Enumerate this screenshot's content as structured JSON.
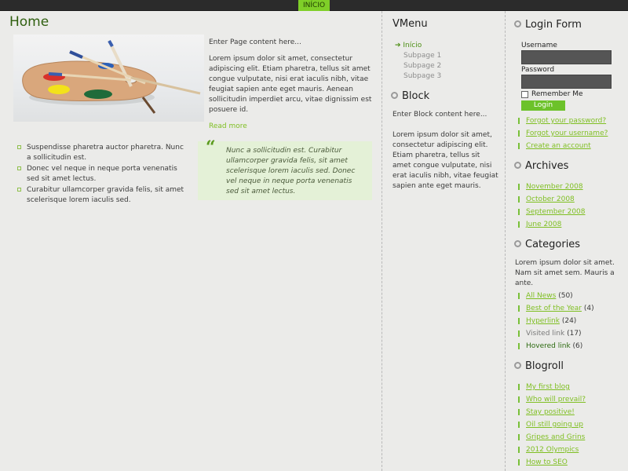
{
  "nav": {
    "item": "INÍCIO"
  },
  "main": {
    "title": "Home",
    "intro": "Enter Page content here...",
    "paragraph": "Lorem ipsum dolor sit amet, consectetur adipiscing elit. Etiam pharetra, tellus sit amet congue vulputate, nisi erat iaculis nibh, vitae feugiat sapien ante eget mauris. Aenean sollicitudin imperdiet arcu, vitae dignissim est posuere id.",
    "read_more": "Read more",
    "bullets": [
      "Suspendisse pharetra auctor pharetra. Nunc a sollicitudin est.",
      "Donec vel neque in neque porta venenatis sed sit amet lectus.",
      "Curabitur ullamcorper gravida felis, sit amet scelerisque lorem iaculis sed."
    ],
    "quote": "Nunc a sollicitudin est. Curabitur ullamcorper gravida felis, sit amet scelerisque lorem iaculis sed. Donec vel neque in neque porta venenatis sed sit amet lectus.",
    "quote_mark": "“"
  },
  "vmenu": {
    "title": "VMenu",
    "active": "Início",
    "subpages": [
      "Subpage 1",
      "Subpage 2",
      "Subpage 3"
    ]
  },
  "block": {
    "title": "Block",
    "intro": "Enter Block content here...",
    "text": "Lorem ipsum dolor sit amet, consectetur adipiscing elit. Etiam pharetra, tellus sit amet congue vulputate, nisi erat iaculis nibh, vitae feugiat sapien ante eget mauris."
  },
  "login": {
    "title": "Login Form",
    "username_label": "Username",
    "password_label": "Password",
    "remember_label": "Remember Me",
    "button": "Login",
    "links": [
      "Forgot your password?",
      "Forgot your username?",
      "Create an account"
    ]
  },
  "archives": {
    "title": "Archives",
    "items": [
      "November 2008",
      "October 2008",
      "September 2008",
      "June 2008"
    ]
  },
  "categories": {
    "title": "Categories",
    "text": "Lorem ipsum dolor sit amet. Nam sit amet sem. Mauris a ante.",
    "items": [
      {
        "label": "All News",
        "count": "(50)"
      },
      {
        "label": "Best of the Year",
        "count": "(4)"
      },
      {
        "label": "Hyperlink",
        "count": "(24)"
      },
      {
        "label": "Visited link",
        "count": "(17)"
      },
      {
        "label": "Hovered link",
        "count": "(6)"
      }
    ]
  },
  "blogroll": {
    "title": "Blogroll",
    "items": [
      "My first blog",
      "Who will prevail?",
      "Stay positive!",
      "Oil still going up",
      "Gripes and Grins",
      "2012 Olympics",
      "How to SEO"
    ]
  },
  "colors": {
    "accent": "#7fcf28",
    "link": "#7fbf22",
    "title_green": "#2f5f0f",
    "quote_bg": "#e4f1d7"
  }
}
